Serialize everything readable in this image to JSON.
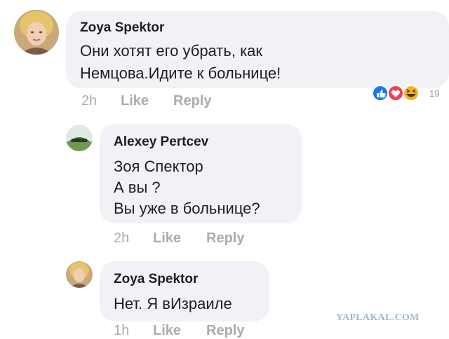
{
  "comments": [
    {
      "author": "Zoya Spektor",
      "lines": [
        "Они хотят его убрать, как",
        "Немцова.Идите к больнице!"
      ],
      "time": "2h",
      "like_label": "Like",
      "reply_label": "Reply",
      "reaction_count": "19",
      "reaction_icons": [
        "like-icon",
        "love-icon",
        "haha-icon"
      ]
    },
    {
      "author": "Alexey Pertcev",
      "lines": [
        "Зоя Спектор",
        "А вы ?",
        "Вы уже в больнице?"
      ],
      "time": "2h",
      "like_label": "Like",
      "reply_label": "Reply"
    },
    {
      "author": "Zoya Spektor",
      "lines": [
        "Нет. Я вИзраиле"
      ],
      "time": "1h",
      "like_label": "Like",
      "reply_label": "Reply"
    }
  ],
  "watermark": "YAPLAKAL.COM",
  "colors": {
    "bubble": "#f0f2f5",
    "action_text": "#a9acb1",
    "like_blue": "#1877f2",
    "love_red": "#f33e58",
    "haha_yellow": "#f7b125"
  }
}
